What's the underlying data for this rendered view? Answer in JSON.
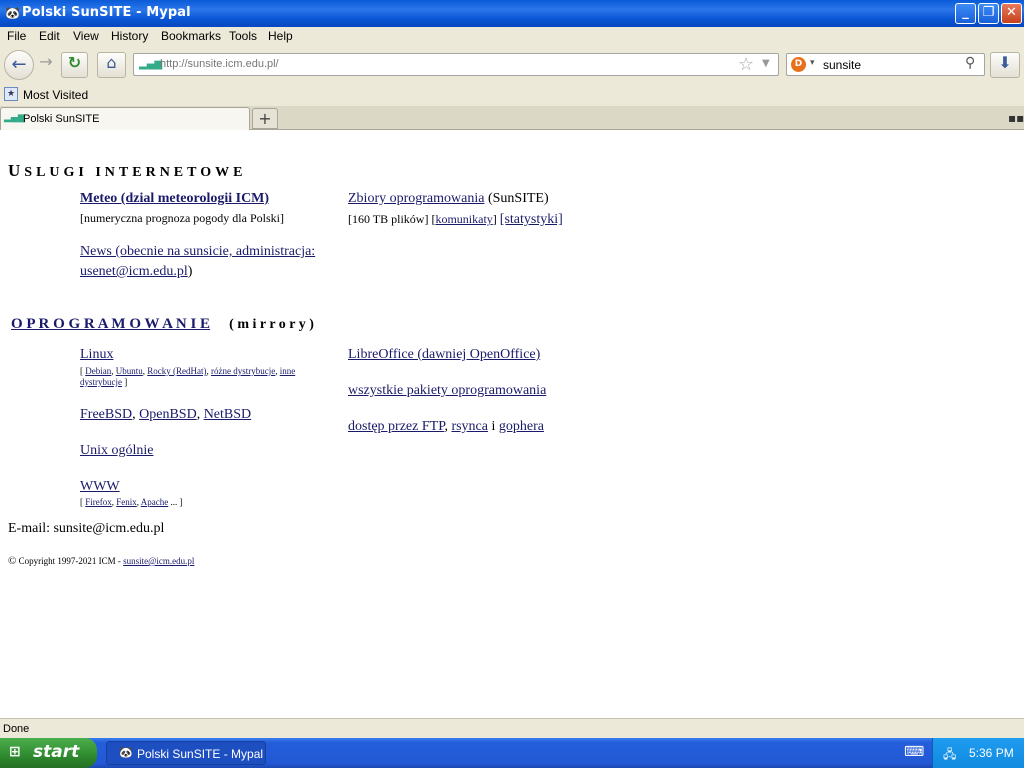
{
  "window": {
    "title": "Polski SunSITE - Mypal"
  },
  "menu": [
    "File",
    "Edit",
    "View",
    "History",
    "Bookmarks",
    "Tools",
    "Help"
  ],
  "urlbar": {
    "url": "http://sunsite.icm.edu.pl/"
  },
  "search": {
    "value": "sunsite"
  },
  "bookmarks": {
    "most_visited": "Most Visited"
  },
  "tab": {
    "label": "Polski SunSITE"
  },
  "page": {
    "section1_title_cap": "U",
    "section1_title_rest": "SLUGI INTERNETOWE",
    "meteo_link": "Meteo (dzial meteorologii ICM)",
    "meteo_desc": "[numeryczna prognoza pogody dla Polski]",
    "news_link_1": "News (obecnie na sunsicie, administracja:",
    "news_link_2": "usenet@icm.edu.pl",
    "news_close": ")",
    "zbiory_link": "Zbiory oprogramowania",
    "zbiory_suffix": " (SunSITE)",
    "zbiory_files": "[160 TB plików] [",
    "komunikaty": "komunikaty",
    "zbiory_mid": "] ",
    "statystyki": "[statystyki]",
    "section2_link": "O P R O G R A M O W A N I E",
    "section2_suffix": "( m i r r o r y )",
    "linux": "Linux",
    "linux_open": "[ ",
    "debian": "Debian",
    "ubuntu": "Ubuntu",
    "rocky": "Rocky (RedHat)",
    "rozne": "różne dystrybucje",
    "inne_1": "inne",
    "inne_2": "dystrybucje",
    "linux_close": " ]",
    "freebsd": "FreeBSD",
    "openbsd": "OpenBSD",
    "netbsd": "NetBSD",
    "unix": "Unix ogólnie",
    "www": "WWW",
    "www_open": "[ ",
    "firefox": "Firefox",
    "fenix": "Fenix",
    "apache": "Apache",
    "www_close": " ... ]",
    "libreoffice": "LibreOffice (dawniej OpenOffice)",
    "pakiety": "wszystkie pakiety oprogramowania",
    "ftp": "dostęp przez FTP",
    "rsynca": "rsynca",
    "i": " i ",
    "gophera": "gophera",
    "email": "E-mail: sunsite@icm.edu.pl",
    "copyright_sym": "©",
    "copyright": " Copyright 1997-2021 ICM - ",
    "copyright_email": "sunsite@icm.edu.pl"
  },
  "status": {
    "text": "Done"
  },
  "taskbar": {
    "start": "start",
    "task_label": "Polski SunSITE - Mypal",
    "clock": "5:36 PM"
  },
  "icons": [
    "mypal-icon",
    "back-icon",
    "forward-icon",
    "reload-icon",
    "home-icon",
    "favicon",
    "star-icon",
    "search-icon",
    "download-icon",
    "most-visited-icon",
    "new-tab-icon",
    "tab-list-icon",
    "windows-logo-icon",
    "keyboard-icon",
    "network-icon"
  ]
}
